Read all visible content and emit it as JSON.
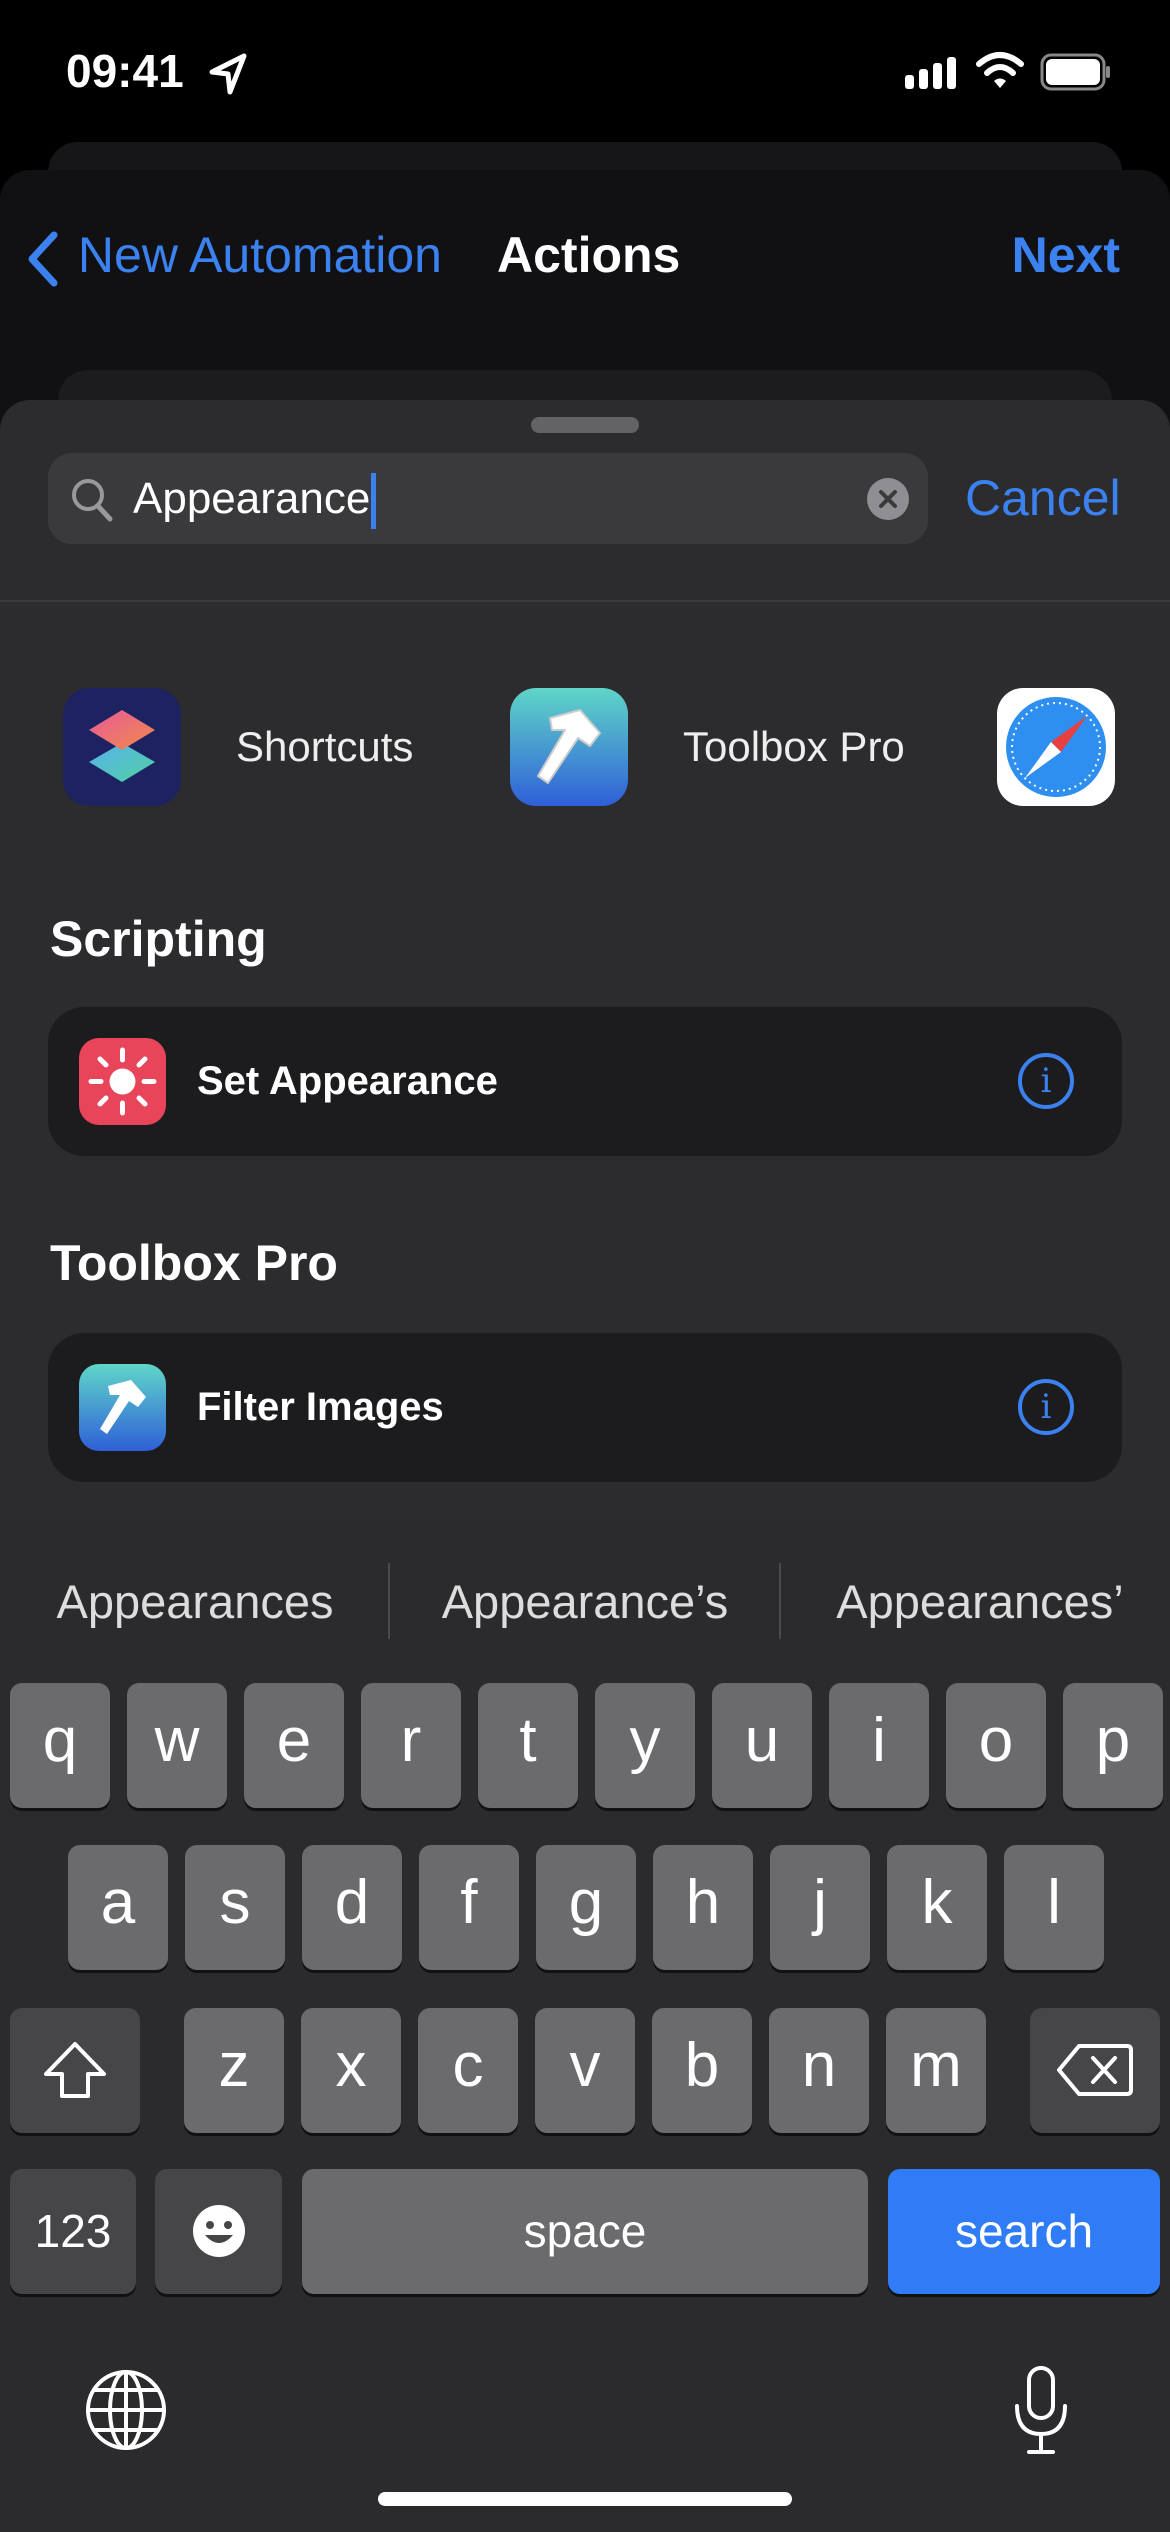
{
  "status_bar": {
    "time": "09:41",
    "icons": [
      "location-arrow-icon",
      "cellular-signal-icon",
      "wifi-icon",
      "battery-icon"
    ]
  },
  "nav": {
    "back_label": "New Automation",
    "title": "Actions",
    "next_label": "Next"
  },
  "search": {
    "value": "Appearance",
    "cancel_label": "Cancel"
  },
  "apps": [
    {
      "label": "Shortcuts",
      "icon": "shortcuts-app-icon"
    },
    {
      "label": "Toolbox Pro",
      "icon": "toolbox-pro-app-icon"
    },
    {
      "label": "",
      "icon": "safari-app-icon"
    }
  ],
  "sections": [
    {
      "title": "Scripting",
      "actions": [
        {
          "label": "Set Appearance",
          "icon": "sun-icon"
        }
      ]
    },
    {
      "title": "Toolbox Pro",
      "actions": [
        {
          "label": "Filter Images",
          "icon": "hammer-icon"
        }
      ]
    }
  ],
  "keyboard": {
    "suggestions": [
      "Appearances",
      "Appearance’s",
      "Appearances’"
    ],
    "row1": [
      "q",
      "w",
      "e",
      "r",
      "t",
      "y",
      "u",
      "i",
      "o",
      "p"
    ],
    "row2": [
      "a",
      "s",
      "d",
      "f",
      "g",
      "h",
      "j",
      "k",
      "l"
    ],
    "row3": [
      "z",
      "x",
      "c",
      "v",
      "b",
      "n",
      "m"
    ],
    "numbers_label": "123",
    "space_label": "space",
    "search_label": "search"
  },
  "colors": {
    "accent": "#3b82f0",
    "search_key": "#2f7cf6",
    "set_appearance_icon": "#e8445a"
  }
}
